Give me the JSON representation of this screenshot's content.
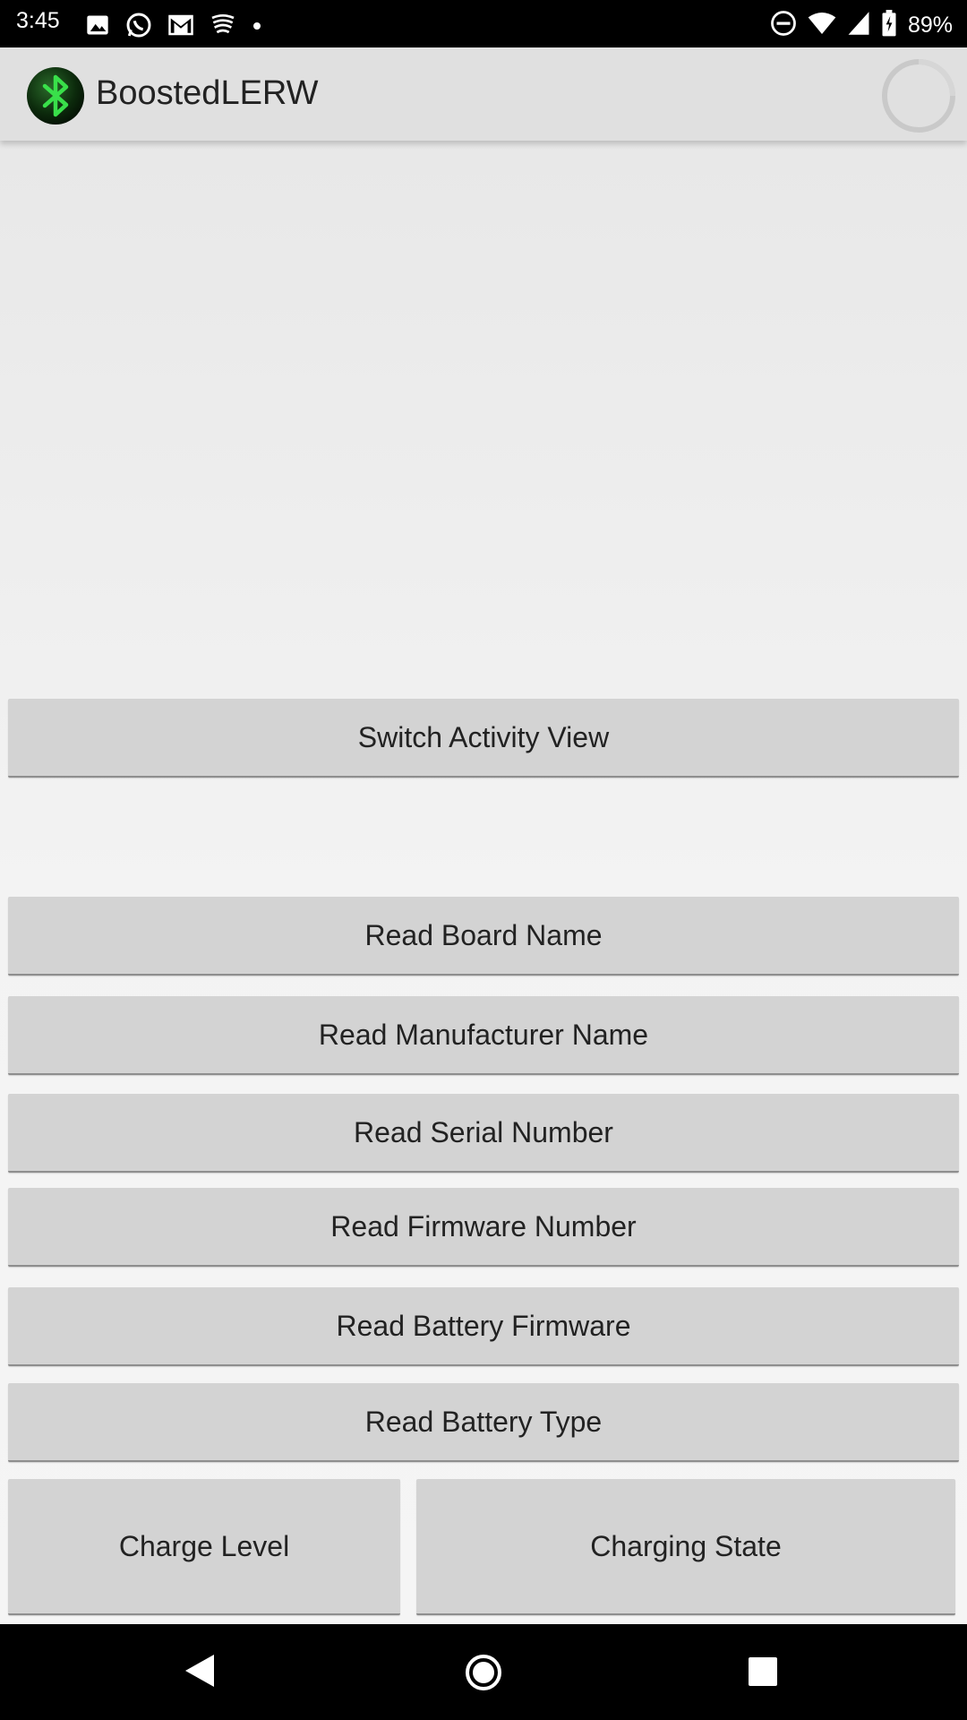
{
  "status_bar": {
    "time": "3:45",
    "battery_percent": "89%",
    "left_icons": [
      "image-icon",
      "whatsapp-icon",
      "gmail-icon",
      "app-notification-icon",
      "dot-icon"
    ],
    "right_icons": [
      "do-not-disturb-icon",
      "wifi-icon",
      "signal-icon",
      "battery-icon"
    ]
  },
  "app_bar": {
    "title": "BoostedLERW",
    "logo": "bluetooth-icon",
    "progress": "loading-spinner"
  },
  "buttons": {
    "switch_activity_view": "Switch Activity View",
    "read_board_name": "Read Board Name",
    "read_manufacturer_name": "Read Manufacturer Name",
    "read_serial_number": "Read Serial Number",
    "read_firmware_number": "Read Firmware Number",
    "read_battery_firmware": "Read Battery Firmware",
    "read_battery_type": "Read Battery Type",
    "charge_level": "Charge Level",
    "charging_state": "Charging State"
  },
  "nav_bar": {
    "back": "back-icon",
    "home": "home-icon",
    "recents": "recents-icon"
  },
  "colors": {
    "accent_green": "#2ecc40",
    "button_bg": "#d3d3d3",
    "app_bar_bg": "#e0e0e0"
  }
}
